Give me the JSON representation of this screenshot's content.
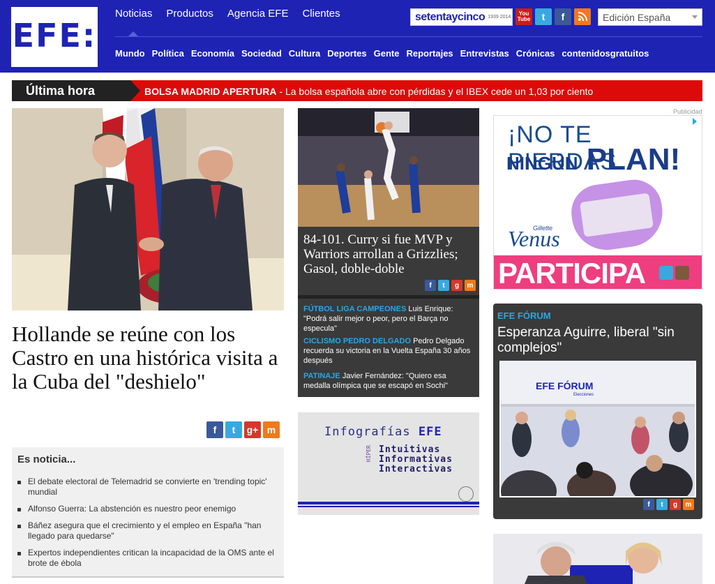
{
  "header": {
    "logo_text": "EFE:",
    "top_nav": [
      "Noticias",
      "Productos",
      "Agencia EFE",
      "Clientes"
    ],
    "sub_nav": [
      "Mundo",
      "Política",
      "Economía",
      "Sociedad",
      "Cultura",
      "Deportes",
      "Gente",
      "Reportajes",
      "Entrevistas",
      "Crónicas"
    ],
    "sub_nav_last_normal": "contenidos",
    "sub_nav_last_bold": "gratuitos",
    "setenta_label": "setentaycinco",
    "setenta_years": "1939 2014",
    "youtube_label": "You Tube",
    "edition_select": "Edición España"
  },
  "breaking": {
    "label": "Última hora",
    "tag": "BOLSA MADRID APERTURA",
    "text": " - La bolsa española abre con pérdidas y el IBEX cede un 1,03 por ciento"
  },
  "main_story": {
    "title": "Hollande se reúne con los Castro en una histórica visita a la Cuba del \"deshielo\""
  },
  "es_noticia": {
    "heading": "Es noticia...",
    "items": [
      "El debate electoral de Telemadrid se convierte en 'trending topic' mundial",
      "Alfonso Guerra: La abstención es nuestro peor enemigo",
      "Báñez asegura que el crecimiento y el empleo en España \"han llegado para quedarse\"",
      "Expertos independientes critican la incapacidad de la OMS ante el brote de ébola"
    ]
  },
  "nba_story": {
    "title": "84-101. Curry si fue MVP y Warriors arrollan a Grizzlies; Gasol, doble-doble"
  },
  "sports": [
    {
      "tag": "FÚTBOL LIGA CAMPEONES",
      "text": " Luis Enrique: \"Podrá salir mejor o peor, pero el Barça no especula\""
    },
    {
      "tag": "CICLISMO PEDRO DELGADO",
      "text": " Pedro Delgado recuerda su victoria en la Vuelta España 30 años después"
    },
    {
      "tag": "PATINAJE",
      "text": " Javier Fernández: \"Quiero esa medalla olímpica que se escapó en Sochi\""
    }
  ],
  "infografias": {
    "title": "Infografías",
    "brand": "EFE",
    "hiper": "HÍPER",
    "lines": [
      "Intuitivas",
      "Informativas",
      "Interactivas"
    ]
  },
  "ad": {
    "publicidad": "Publicidad",
    "line1": "¡NO TE PIERDAS",
    "line2_small": "NINGÚN",
    "line2_big": "PLAN!",
    "brand": "Venus",
    "brand_small": "Gillette",
    "cta": "PARTICIPA"
  },
  "forum": {
    "tag": "EFE FÓRUM",
    "title": "Esperanza Aguirre, liberal \"sin complejos\"",
    "photo_sign": "EFE FÓRUM",
    "photo_sign_sub": "Elecciones"
  },
  "colors": {
    "efe_blue": "#1e23b4",
    "breaking_red": "#dd0a0a",
    "dark_box": "#3a3a3a",
    "tag_cyan": "#2aa7e6"
  }
}
